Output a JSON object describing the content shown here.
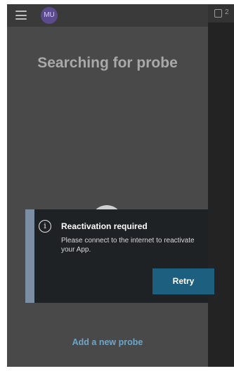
{
  "header": {
    "avatar_initials": "MU",
    "menu_icon": "hamburger-menu-icon"
  },
  "main": {
    "title": "Searching for probe",
    "add_probe_link": "Add a new probe"
  },
  "side_panel": {
    "badge_text": "2",
    "icon": "clipboard-icon"
  },
  "dialog": {
    "icon": "info-icon",
    "icon_glyph": "i",
    "title": "Reactivation required",
    "message": "Please connect to the internet to reactivate your App.",
    "retry_label": "Retry"
  },
  "colors": {
    "background": "#494949",
    "dialog_bg": "#1f2225",
    "accent_bar": "#7b8ea3",
    "button": "#1c5f7e",
    "link": "#6ea6c9",
    "avatar": "#5b4a8c"
  }
}
